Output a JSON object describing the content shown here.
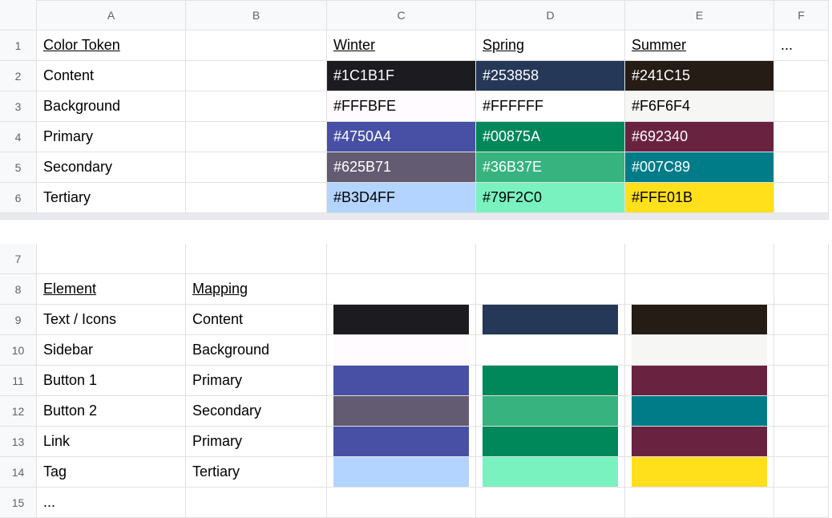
{
  "columns": [
    "A",
    "B",
    "C",
    "D",
    "E",
    "F"
  ],
  "row_numbers": [
    1,
    2,
    3,
    4,
    5,
    6,
    7,
    8,
    9,
    10,
    11,
    12,
    13,
    14,
    15
  ],
  "r1": {
    "A": "Color Token",
    "C": "Winter",
    "D": "Spring",
    "E": "Summer",
    "F": "..."
  },
  "r2": {
    "A": "Content",
    "C": {
      "text": "#1C1B1F",
      "bg": "#1C1B1F",
      "fg": "#FFFFFF"
    },
    "D": {
      "text": "#253858",
      "bg": "#253858",
      "fg": "#FFFFFF"
    },
    "E": {
      "text": "#241C15",
      "bg": "#241C15",
      "fg": "#FFFFFF"
    }
  },
  "r3": {
    "A": "Background",
    "C": {
      "text": "#FFFBFE",
      "bg": "#FFFBFE",
      "fg": "#000000"
    },
    "D": {
      "text": "#FFFFFF",
      "bg": "#FFFFFF",
      "fg": "#000000"
    },
    "E": {
      "text": "#F6F6F4",
      "bg": "#F6F6F4",
      "fg": "#000000"
    }
  },
  "r4": {
    "A": "Primary",
    "C": {
      "text": "#4750A4",
      "bg": "#4750A4",
      "fg": "#FFFFFF"
    },
    "D": {
      "text": "#00875A",
      "bg": "#00875A",
      "fg": "#FFFFFF"
    },
    "E": {
      "text": "#692340",
      "bg": "#692340",
      "fg": "#FFFFFF"
    }
  },
  "r5": {
    "A": "Secondary",
    "C": {
      "text": "#625B71",
      "bg": "#625B71",
      "fg": "#FFFFFF"
    },
    "D": {
      "text": "#36B37E",
      "bg": "#36B37E",
      "fg": "#FFFFFF"
    },
    "E": {
      "text": "#007C89",
      "bg": "#007C89",
      "fg": "#FFFFFF"
    }
  },
  "r6": {
    "A": "Tertiary",
    "C": {
      "text": "#B3D4FF",
      "bg": "#B3D4FF",
      "fg": "#000000"
    },
    "D": {
      "text": "#79F2C0",
      "bg": "#79F2C0",
      "fg": "#000000"
    },
    "E": {
      "text": "#FFE01B",
      "bg": "#FFE01B",
      "fg": "#000000"
    }
  },
  "r8": {
    "A": "Element",
    "B": "Mapping"
  },
  "r9": {
    "A": "Text / Icons",
    "B": "Content",
    "C": "#1C1B1F",
    "D": "#253858",
    "E": "#241C15"
  },
  "r10": {
    "A": "Sidebar",
    "B": "Background",
    "C": "#FFFBFE",
    "D": "#FFFFFF",
    "E": "#F6F6F4"
  },
  "r11": {
    "A": "Button 1",
    "B": "Primary",
    "C": "#4750A4",
    "D": "#00875A",
    "E": "#692340"
  },
  "r12": {
    "A": "Button 2",
    "B": "Secondary",
    "C": "#625B71",
    "D": "#36B37E",
    "E": "#007C89"
  },
  "r13": {
    "A": "Link",
    "B": "Primary",
    "C": "#4750A4",
    "D": "#00875A",
    "E": "#692340"
  },
  "r14": {
    "A": "Tag",
    "B": "Tertiary",
    "C": "#B3D4FF",
    "D": "#79F2C0",
    "E": "#FFE01B"
  },
  "r15": {
    "A": "..."
  }
}
